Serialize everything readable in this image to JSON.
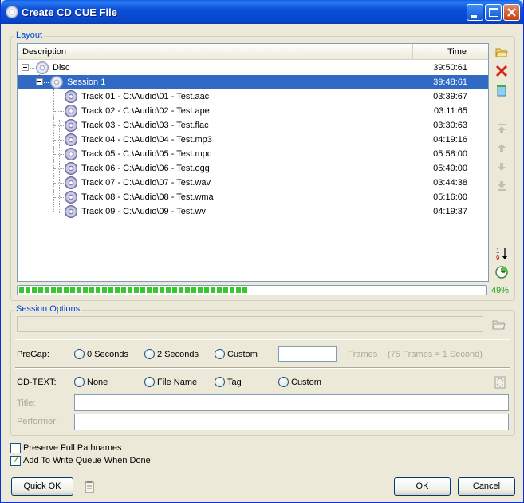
{
  "window": {
    "title": "Create CD CUE File"
  },
  "layout": {
    "group_label": "Layout",
    "columns": {
      "description": "Description",
      "time": "Time"
    },
    "disc": {
      "label": "Disc",
      "time": "39:50:61"
    },
    "session": {
      "label": "Session 1",
      "time": "39:48:61"
    },
    "tracks": [
      {
        "label": "Track 01 - C:\\Audio\\01 - Test.aac",
        "time": "03:39:67"
      },
      {
        "label": "Track 02 - C:\\Audio\\02 - Test.ape",
        "time": "03:11:65"
      },
      {
        "label": "Track 03 - C:\\Audio\\03 - Test.flac",
        "time": "03:30:63"
      },
      {
        "label": "Track 04 - C:\\Audio\\04 - Test.mp3",
        "time": "04:19:16"
      },
      {
        "label": "Track 05 - C:\\Audio\\05 - Test.mpc",
        "time": "05:58:00"
      },
      {
        "label": "Track 06 - C:\\Audio\\06 - Test.ogg",
        "time": "05:49:00"
      },
      {
        "label": "Track 07 - C:\\Audio\\07 - Test.wav",
        "time": "03:44:38"
      },
      {
        "label": "Track 08 - C:\\Audio\\08 - Test.wma",
        "time": "05:16:00"
      },
      {
        "label": "Track 09 - C:\\Audio\\09 - Test.wv",
        "time": "04:19:37"
      }
    ],
    "side_icons": [
      "open-folder-icon",
      "delete-icon",
      "clear-icon",
      "move-top-icon",
      "move-up-icon",
      "move-down-icon",
      "move-bottom-icon",
      "sort-icon",
      "clock-icon"
    ],
    "progress": {
      "percent": 49,
      "label": "49%"
    }
  },
  "session_options": {
    "group_label": "Session Options",
    "path_value": "",
    "pregap": {
      "label": "PreGap:",
      "options": [
        "0 Seconds",
        "2 Seconds",
        "Custom"
      ],
      "frames_value": "",
      "frames_label": "Frames",
      "frames_hint": "(75 Frames = 1 Second)"
    },
    "cdtext": {
      "label": "CD-TEXT:",
      "options": [
        "None",
        "File Name",
        "Tag",
        "Custom"
      ]
    },
    "title": {
      "label": "Title:",
      "value": ""
    },
    "performer": {
      "label": "Performer:",
      "value": ""
    }
  },
  "options": {
    "preserve_paths": {
      "label": "Preserve Full Pathnames",
      "checked": false
    },
    "add_to_queue": {
      "label": "Add To Write Queue When Done",
      "checked": true
    }
  },
  "buttons": {
    "quick_ok": "Quick OK",
    "ok": "OK",
    "cancel": "Cancel"
  }
}
